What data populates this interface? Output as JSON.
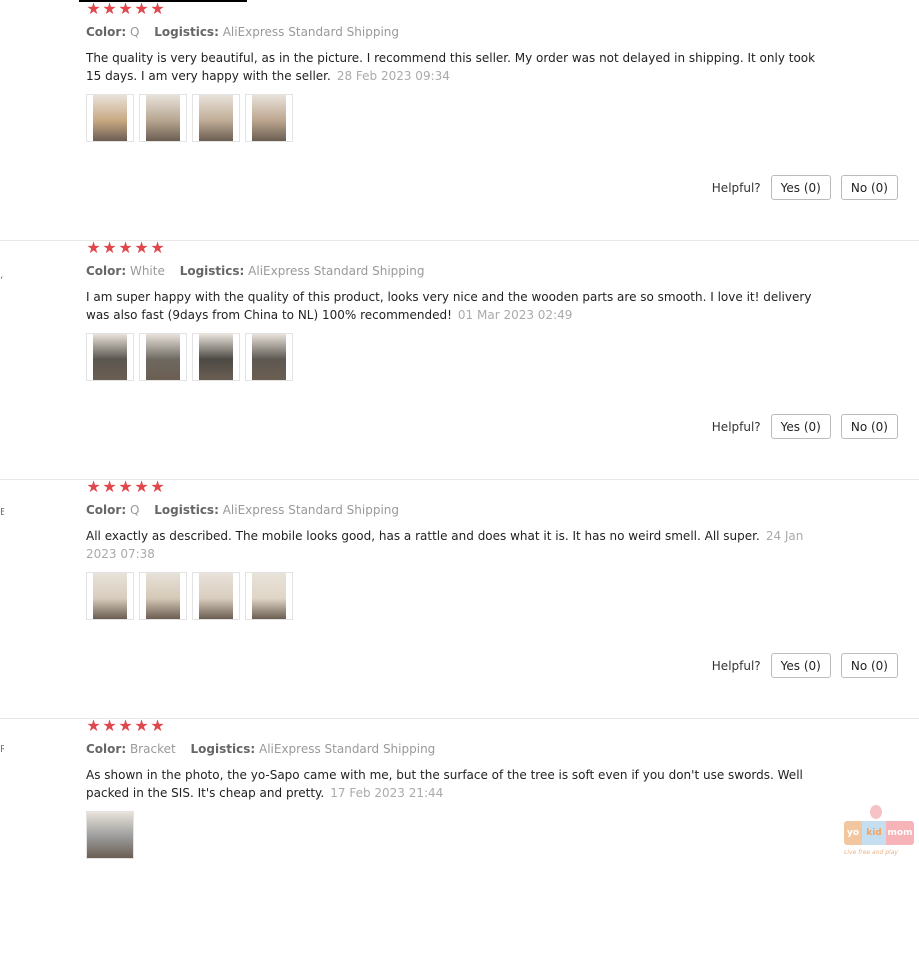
{
  "labels": {
    "color": "Color:",
    "logistics": "Logistics:",
    "helpful": "Helpful?",
    "yes": "Yes (0)",
    "no": "No (0)"
  },
  "edge_marks": [
    ",",
    "E",
    "R"
  ],
  "reviews": [
    {
      "stars": 5,
      "color": "Q",
      "logistics": "AliExpress Standard Shipping",
      "text": "The quality is very beautiful, as in the picture. I recommend this seller. My order was not delayed in shipping. It only took 15 days. I am very happy with the seller.",
      "date": "28 Feb 2023 09:34",
      "photos": 4,
      "photo_colors": [
        "#c9a983",
        "#b7a691",
        "#c1ad97",
        "#bda690"
      ]
    },
    {
      "stars": 5,
      "color": "White",
      "logistics": "AliExpress Standard Shipping",
      "text": "I am super happy with the quality of this product, looks very nice and the wooden parts are so smooth. I love it! delivery was also fast (9days from China to NL) 100% recommended!",
      "date": "01 Mar 2023 02:49",
      "photos": 4,
      "photo_colors": [
        "#5b5650",
        "#6e6961",
        "#4d4a45",
        "#5d5852"
      ]
    },
    {
      "stars": 5,
      "color": "Q",
      "logistics": "AliExpress Standard Shipping",
      "text": "All exactly as described. The mobile looks good, has a rattle and does what it is. It has no weird smell. All super.",
      "date": "24 Jan 2023 07:38",
      "photos": 4,
      "photo_colors": [
        "#d8cdbd",
        "#d5c8b6",
        "#d9cebf",
        "#e0d6c6"
      ]
    },
    {
      "stars": 5,
      "color": "Bracket",
      "logistics": "AliExpress Standard Shipping",
      "text": "As shown in the photo, the yo-Sapo came with me, but the surface of the tree is soft even if you don't use swords. Well packed in the SIS. It's cheap and pretty.",
      "date": "17 Feb 2023 21:44",
      "photos": 1,
      "photo_colors": [
        "#9a9a9a"
      ]
    }
  ],
  "watermark": {
    "segments": [
      "yo",
      "kid",
      "mom"
    ],
    "tagline": "Live free and play"
  },
  "colors": {
    "star": "#e0484d",
    "meta_value": "#999999",
    "date": "#aaaaaa"
  }
}
